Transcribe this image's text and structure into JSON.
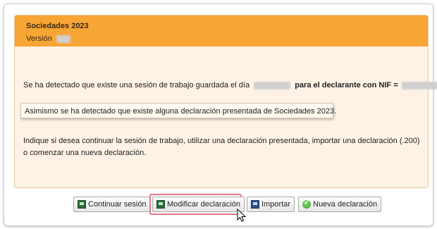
{
  "header": {
    "title": "Sociedades 2023",
    "version_label": "Versión"
  },
  "body": {
    "message_prefix": "Se ha detectado que existe una sesión de trabajo guardada el día",
    "message_bold": "para el declarante con NIF =",
    "notice": "Asimismo se ha detectado que existe alguna declaración presentada de Sociedades 2023.",
    "instructions": "Indique si desea continuar la sesión de trabajo, utilizar una declaración presentada, importar una declaración (.200) o comenzar una nueva declaración."
  },
  "buttons": {
    "continue": "Continuar sesión",
    "modify": "Modificar declaración",
    "import": "Importar",
    "new": "Nueva declaración"
  },
  "colors": {
    "header_bg": "#f7a535",
    "panel_bg": "#fdf2e5",
    "highlight": "#e07a86"
  },
  "icons": {
    "continue": "document-icon",
    "modify": "document-icon",
    "import": "import-icon",
    "new": "check-icon"
  }
}
